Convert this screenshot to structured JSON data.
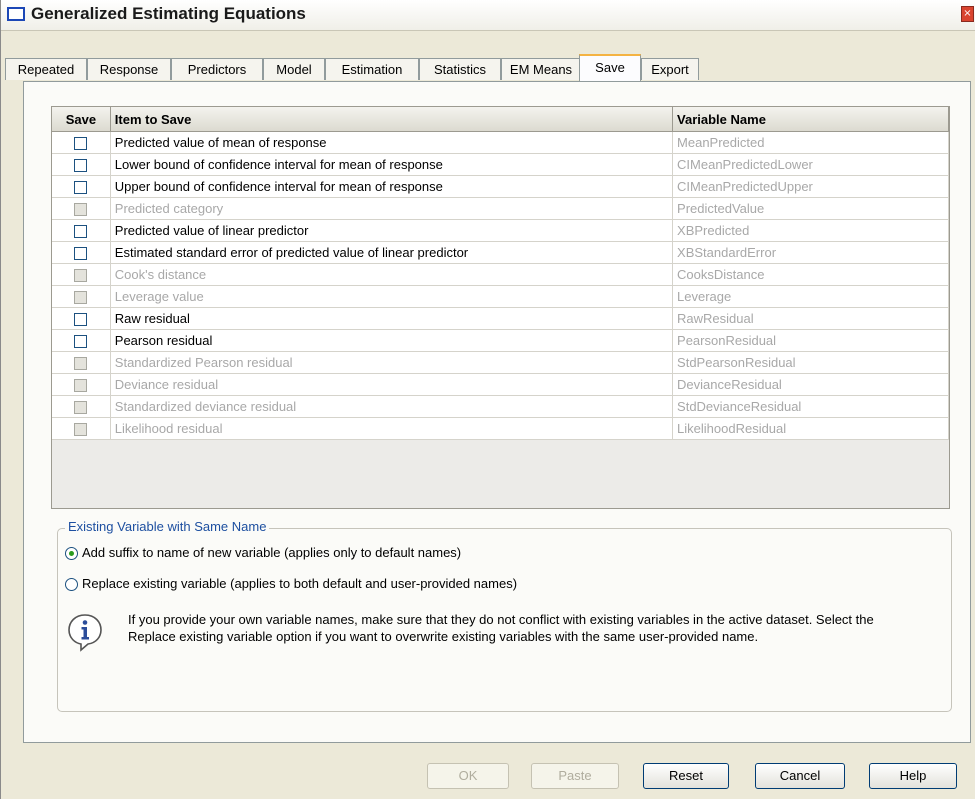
{
  "window": {
    "title": "Generalized Estimating Equations",
    "close_glyph": "×"
  },
  "tabs": [
    "Repeated",
    "Response",
    "Predictors",
    "Model",
    "Estimation",
    "Statistics",
    "EM Means",
    "Save",
    "Export"
  ],
  "active_tab": "Save",
  "table": {
    "headers": {
      "save": "Save",
      "item": "Item to Save",
      "var": "Variable Name"
    },
    "rows": [
      {
        "item": "Predicted value of mean of response",
        "var": "MeanPredicted",
        "enabled": true,
        "checked": false
      },
      {
        "item": "Lower bound of confidence interval for mean of response",
        "var": "CIMeanPredictedLower",
        "enabled": true,
        "checked": false
      },
      {
        "item": "Upper bound of confidence interval for mean of response",
        "var": "CIMeanPredictedUpper",
        "enabled": true,
        "checked": false
      },
      {
        "item": "Predicted category",
        "var": "PredictedValue",
        "enabled": false,
        "checked": false
      },
      {
        "item": "Predicted value of linear predictor",
        "var": "XBPredicted",
        "enabled": true,
        "checked": false
      },
      {
        "item": "Estimated standard error of predicted value of linear predictor",
        "var": "XBStandardError",
        "enabled": true,
        "checked": false
      },
      {
        "item": "Cook's distance",
        "var": "CooksDistance",
        "enabled": false,
        "checked": false
      },
      {
        "item": "Leverage value",
        "var": "Leverage",
        "enabled": false,
        "checked": false
      },
      {
        "item": "Raw residual",
        "var": "RawResidual",
        "enabled": true,
        "checked": false
      },
      {
        "item": "Pearson residual",
        "var": "PearsonResidual",
        "enabled": true,
        "checked": false
      },
      {
        "item": "Standardized Pearson residual",
        "var": "StdPearsonResidual",
        "enabled": false,
        "checked": false
      },
      {
        "item": "Deviance residual",
        "var": "DevianceResidual",
        "enabled": false,
        "checked": false
      },
      {
        "item": "Standardized deviance residual",
        "var": "StdDevianceResidual",
        "enabled": false,
        "checked": false
      },
      {
        "item": "Likelihood residual",
        "var": "LikelihoodResidual",
        "enabled": false,
        "checked": false
      }
    ]
  },
  "existing_group": {
    "legend": "Existing Variable with Same Name",
    "option_add": "Add suffix to name of new variable (applies only to default names)",
    "option_replace": "Replace existing variable (applies to both default and user-provided names)",
    "selected": "add",
    "info": "If you provide your own variable names, make sure that they do not conflict with existing variables in the active dataset.  Select the Replace existing variable option if you want to overwrite existing variables with the same user-provided name."
  },
  "buttons": {
    "ok": "OK",
    "paste": "Paste",
    "reset": "Reset",
    "cancel": "Cancel",
    "help": "Help"
  },
  "icons": {
    "title": "window-icon",
    "info": "info-icon"
  }
}
